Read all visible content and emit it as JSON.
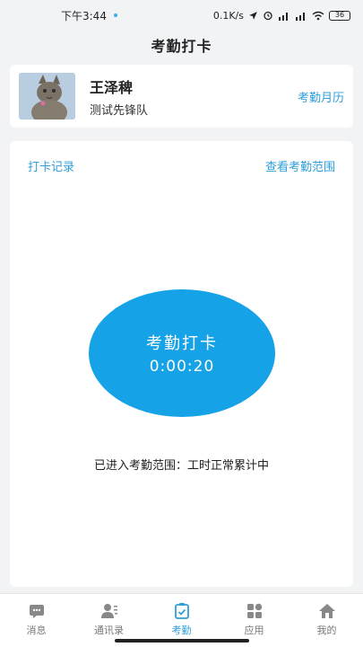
{
  "status_bar": {
    "time": "下午3:44",
    "network_speed": "0.1K/s",
    "battery": "36"
  },
  "header": {
    "title": "考勤打卡"
  },
  "profile": {
    "name": "王泽稗",
    "team": "测试先锋队",
    "calendar_link": "考勤月历"
  },
  "attendance": {
    "records_link": "打卡记录",
    "range_link": "查看考勤范围",
    "punch_label": "考勤打卡",
    "elapsed_time": "0:00:20",
    "range_status": "已进入考勤范围：工时正常累计中"
  },
  "tabs": [
    {
      "label": "消息",
      "icon": "message-icon"
    },
    {
      "label": "通讯录",
      "icon": "contacts-icon"
    },
    {
      "label": "考勤",
      "icon": "attendance-icon",
      "active": true
    },
    {
      "label": "应用",
      "icon": "apps-icon"
    },
    {
      "label": "我的",
      "icon": "home-icon"
    }
  ],
  "colors": {
    "accent": "#2f9ed8",
    "punch_button": "#16a2e6"
  }
}
